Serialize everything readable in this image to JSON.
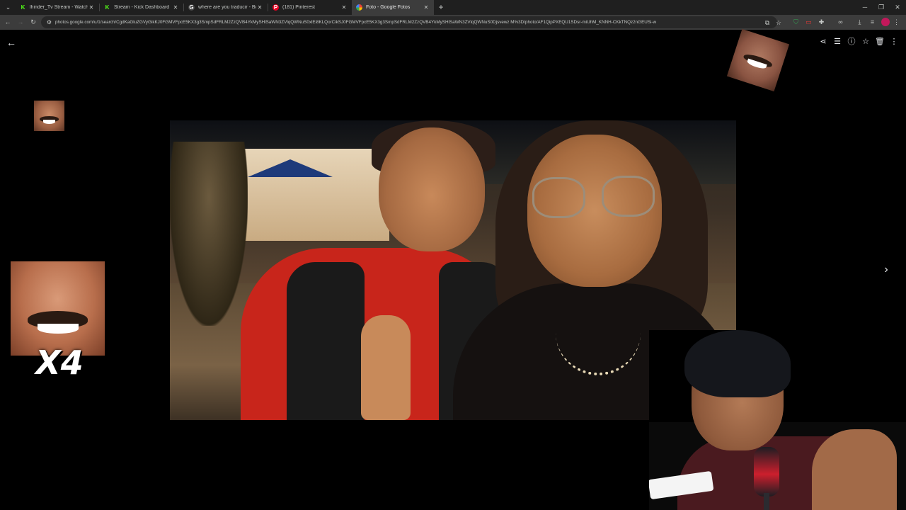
{
  "browser": {
    "tabs": [
      {
        "title": "lhinder_Tv Stream - Watch Live",
        "icon": "kick-icon",
        "active": false
      },
      {
        "title": "Stream - Kick Dashboard",
        "icon": "kick-icon",
        "active": false
      },
      {
        "title": "where are you traducir - Buscar",
        "icon": "google-icon",
        "active": false
      },
      {
        "title": "(181) Pinterest",
        "icon": "pinterest-icon",
        "active": false
      },
      {
        "title": "Foto - Google Fotos",
        "icon": "google-photos-icon",
        "active": true
      }
    ],
    "url": "photos.google.com/u/1/search/CgdKaGluZGVyGikKJ0FGMVFpcE5KX3g3SmpSdFRLM2ZzQVB4YkMySHlSaWN3ZVlqQWNuS0xlEi8KLQorCikSJ0FGMVFpcE5KX3g3SmpSdFRLM2ZzQVB4YkMySHlSaWN3ZVlqQWNuS0Djsvewz M%3D/photo/AF1QipPXEQU1SDsr-miUhM_KNNH-CKkTNQz2nGEUSi-w"
  },
  "viewer": {
    "emote_multiplier": "X4"
  },
  "colors": {
    "kick_green": "#53fc18",
    "pinterest_red": "#e60023",
    "background": "#000000"
  }
}
